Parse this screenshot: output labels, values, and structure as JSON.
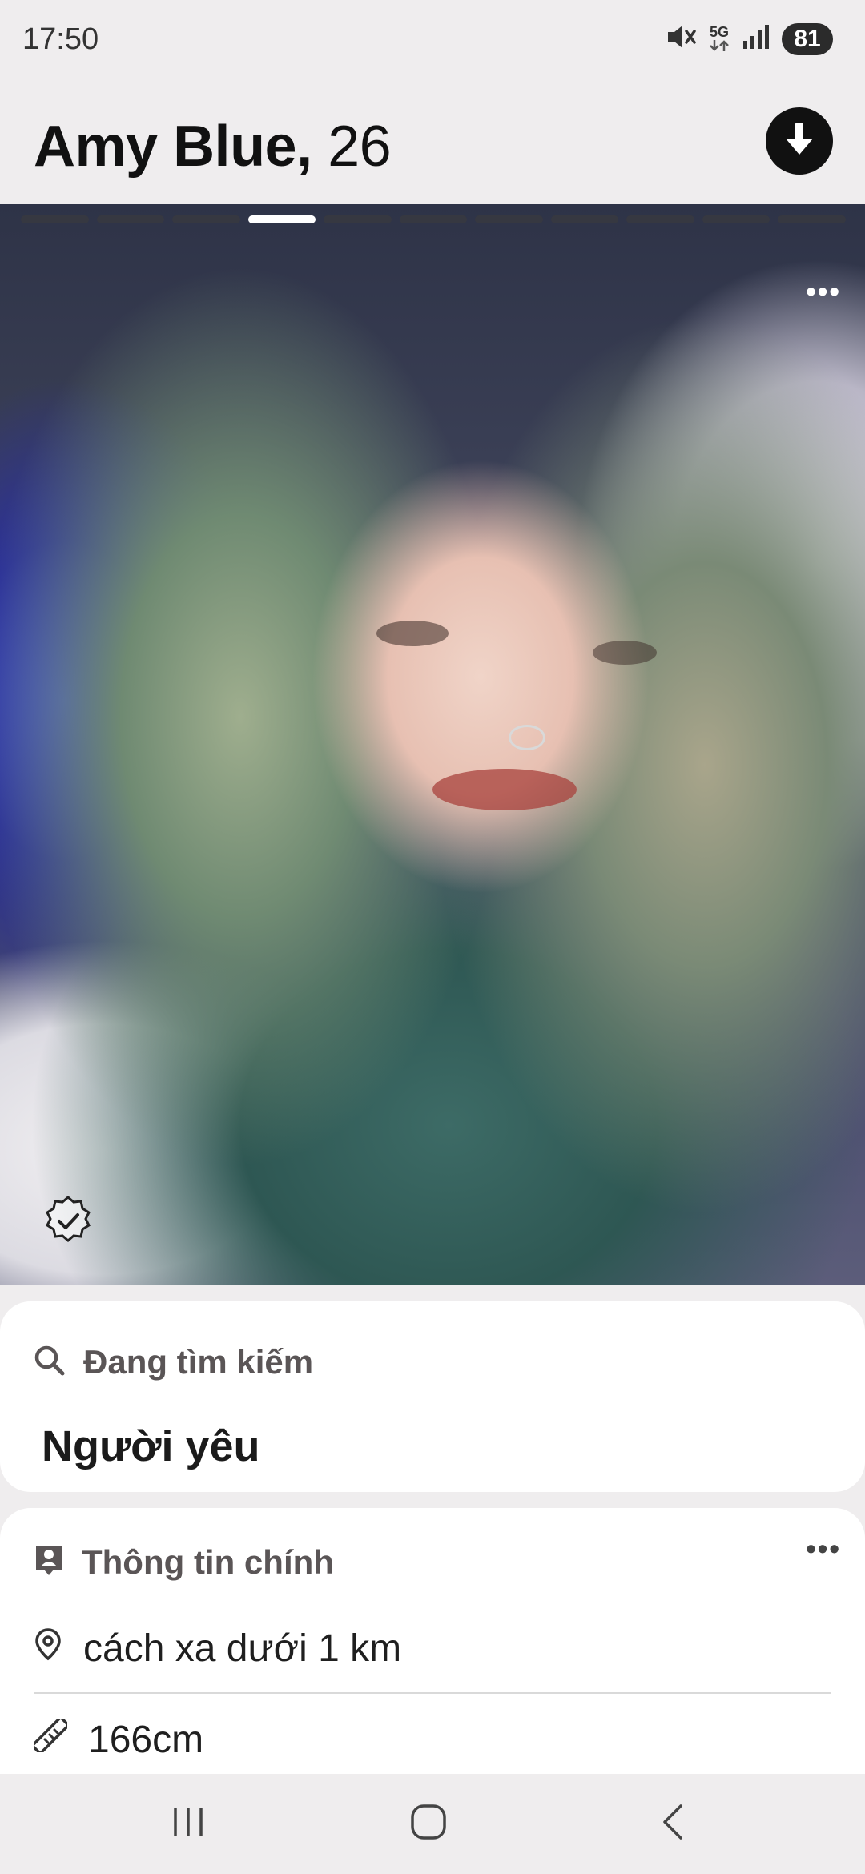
{
  "status_bar": {
    "time": "17:50",
    "network": "5G",
    "battery": "81"
  },
  "profile": {
    "name": "Amy Blue,",
    "age": "26",
    "photo_count": 11,
    "active_photo_index": 4
  },
  "looking_for": {
    "title": "Đang tìm kiếm",
    "value": "Người yêu"
  },
  "main_info": {
    "title": "Thông tin chính",
    "distance": "cách xa dưới 1 km",
    "height": "166cm"
  },
  "icons": {
    "download": "arrow-down-circle-icon",
    "more": "more-dots-icon",
    "verified": "verified-badge-icon",
    "search": "search-icon",
    "profile_card": "contact-card-icon",
    "location": "location-pin-icon",
    "ruler": "ruler-icon"
  },
  "colors": {
    "background": "#efedee",
    "card": "#ffffff",
    "accent_dark": "#111111"
  }
}
